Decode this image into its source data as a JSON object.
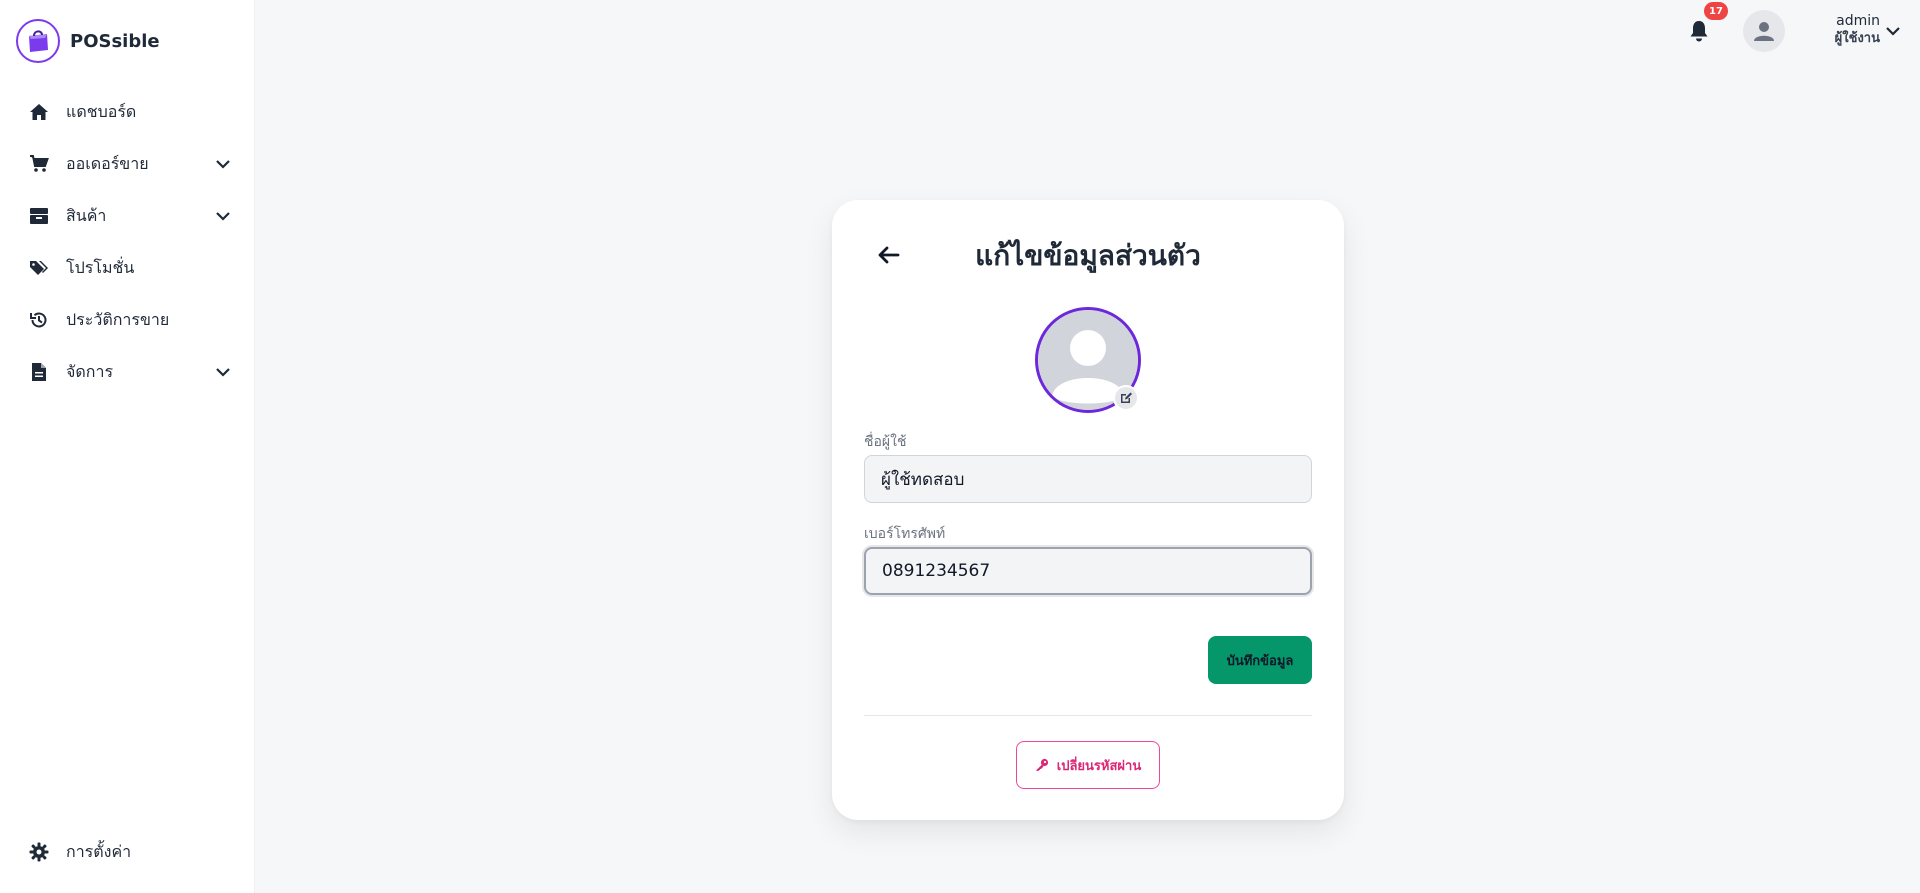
{
  "app": {
    "name": "POSsible",
    "logo_icon": "shopping-bag-logo-icon"
  },
  "sidebar": {
    "items": [
      {
        "label": "แดชบอร์ด",
        "icon": "home-icon",
        "has_submenu": false
      },
      {
        "label": "ออเดอร์ขาย",
        "icon": "cart-icon",
        "has_submenu": true
      },
      {
        "label": "สินค้า",
        "icon": "box-icon",
        "has_submenu": true
      },
      {
        "label": "โปรโมชั่น",
        "icon": "tags-icon",
        "has_submenu": false
      },
      {
        "label": "ประวัติการขาย",
        "icon": "history-icon",
        "has_submenu": false
      },
      {
        "label": "จัดการ",
        "icon": "document-icon",
        "has_submenu": true
      }
    ],
    "settings": {
      "label": "การตั้งค่า",
      "icon": "gear-icon"
    }
  },
  "topbar": {
    "notification_count": "17",
    "user": {
      "name": "admin",
      "role": "ผู้ใช้งาน"
    }
  },
  "profile_form": {
    "title": "แก้ไขข้อมูลส่วนตัว",
    "username_label": "ชื่อผู้ใช้",
    "username_value": "ผู้ใช้ทดสอบ",
    "phone_label": "เบอร์โทรศัพท์",
    "phone_value": "0891234567",
    "save_label": "บันทึกข้อมูล",
    "change_password_label": "เปลี่ยนรหัสผ่าน"
  },
  "colors": {
    "accent_purple": "#6d28d9",
    "save_green": "#059669",
    "password_pink": "#ec4899",
    "badge_red": "#ef4444"
  }
}
